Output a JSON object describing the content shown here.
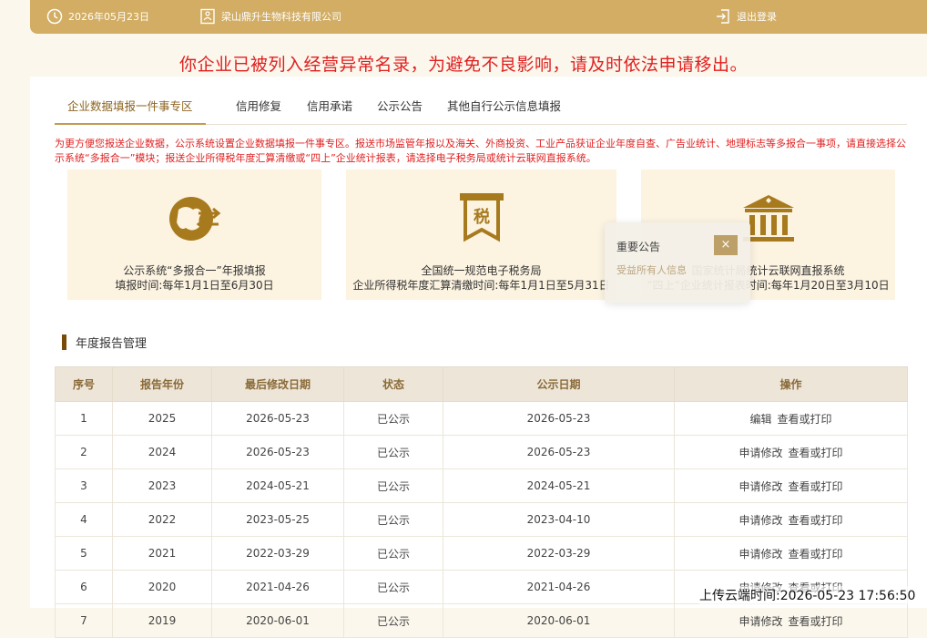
{
  "header": {
    "date": "2026年05月23日",
    "company": "梁山鼎升生物科技有限公司",
    "logout": "退出登录"
  },
  "warning": "你企业已被列入经营异常名录，为避免不良影响，请及时依法申请移出。",
  "tabs": [
    "企业数据填报一件事专区",
    "信用修复",
    "信用承诺",
    "公示公告",
    "其他自行公示信息填报"
  ],
  "notice": "为更方便您报送企业数据，公示系统设置企业数据填报一件事专区。报送市场监管年报以及海关、外商投资、工业产品获证企业年度自查、广告业统计、地理标志等多报合一事项，请直接选择公示系统“多报合一”模块；报送企业所得税年度汇算清缴或“四上”企业统计报表，请选择电子税务局或统计云联网直报系统。",
  "cards": [
    {
      "line1": "公示系统“多报合一”年报填报",
      "line2": "填报时间:每年1月1日至6月30日",
      "icon": "globe-exchange-icon"
    },
    {
      "line1": "全国统一规范电子税务局",
      "line2": "企业所得税年度汇算清缴时间:每年1月1日至5月31日",
      "icon": "tax-icon",
      "icon_text": "税"
    },
    {
      "line1": "国家统计局统计云联网直报系统",
      "line2": "“四上”企业统计报表时间:每年1月20日至3月10日",
      "icon": "government-building-icon"
    }
  ],
  "popup": {
    "title": "重要公告",
    "close": "×",
    "body": "受益所有人信息"
  },
  "section_title": "年度报告管理",
  "table": {
    "headers": [
      "序号",
      "报告年份",
      "最后修改日期",
      "状态",
      "公示日期",
      "操作"
    ],
    "rows": [
      {
        "no": "1",
        "year": "2025",
        "modified": "2026-05-23",
        "status": "已公示",
        "published": "2026-05-23",
        "op1": "编辑",
        "op2": "查看或打印"
      },
      {
        "no": "2",
        "year": "2024",
        "modified": "2026-05-23",
        "status": "已公示",
        "published": "2026-05-23",
        "op1": "申请修改",
        "op2": "查看或打印"
      },
      {
        "no": "3",
        "year": "2023",
        "modified": "2024-05-21",
        "status": "已公示",
        "published": "2024-05-21",
        "op1": "申请修改",
        "op2": "查看或打印"
      },
      {
        "no": "4",
        "year": "2022",
        "modified": "2023-05-25",
        "status": "已公示",
        "published": "2023-04-10",
        "op1": "申请修改",
        "op2": "查看或打印"
      },
      {
        "no": "5",
        "year": "2021",
        "modified": "2022-03-29",
        "status": "已公示",
        "published": "2022-03-29",
        "op1": "申请修改",
        "op2": "查看或打印"
      },
      {
        "no": "6",
        "year": "2020",
        "modified": "2021-04-26",
        "status": "已公示",
        "published": "2021-04-26",
        "op1": "申请修改",
        "op2": "查看或打印"
      },
      {
        "no": "7",
        "year": "2019",
        "modified": "2020-06-01",
        "status": "已公示",
        "published": "2020-06-01",
        "op1": "申请修改",
        "op2": "查看或打印"
      }
    ]
  },
  "upload_time": "上传云端时间:2026-05-23 17:56:50",
  "colors": {
    "accent": "#d2ad63",
    "warning": "#e01f1f",
    "icon": "#a77a1e"
  }
}
